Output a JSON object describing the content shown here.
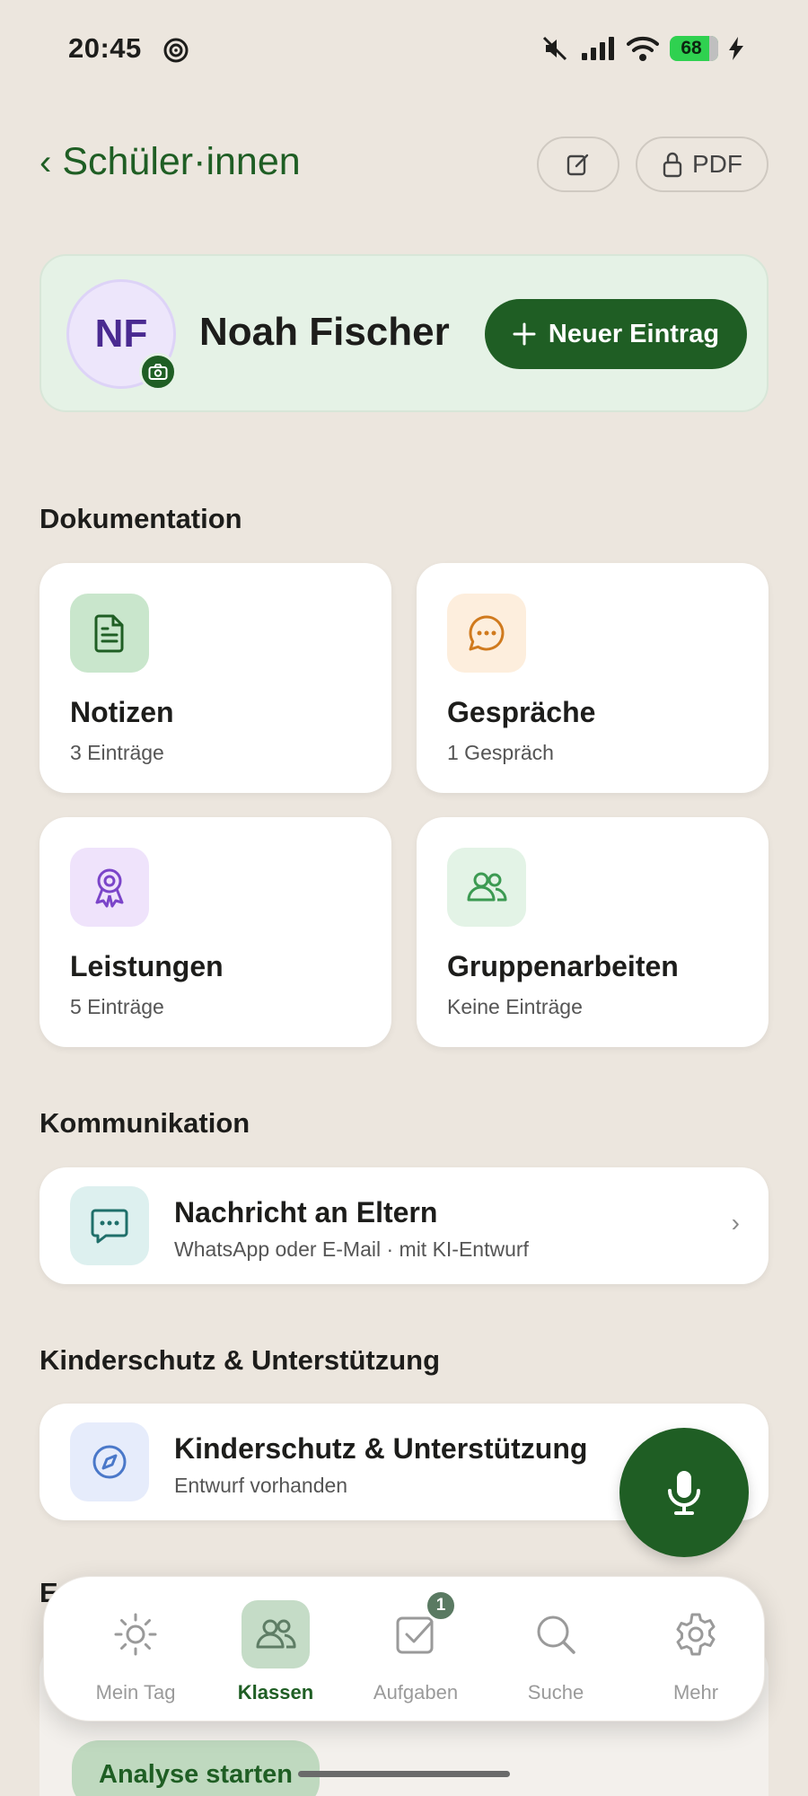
{
  "status_bar": {
    "time": "20:45",
    "battery": "68"
  },
  "header": {
    "back_label": "Schüler·innen",
    "pdf_label": "PDF"
  },
  "profile": {
    "initials": "NF",
    "name": "Noah Fischer",
    "new_entry_label": "Neuer Eintrag"
  },
  "sections": {
    "documentation": "Dokumentation",
    "communication": "Kommunikation",
    "child_protection": "Kinderschutz & Unterstützung",
    "partial_next": "E"
  },
  "tiles": [
    {
      "title": "Notizen",
      "subtitle": "3 Einträge",
      "icon": "document-icon",
      "icon_bg": "#c9e6cc",
      "icon_color": "#1f5e24"
    },
    {
      "title": "Gespräche",
      "subtitle": "1 Gespräch",
      "icon": "chat-bubble-icon",
      "icon_bg": "#fdeedd",
      "icon_color": "#d07a1e"
    },
    {
      "title": "Leistungen",
      "subtitle": "5 Einträge",
      "icon": "award-icon",
      "icon_bg": "#efe3fb",
      "icon_color": "#7b45c9"
    },
    {
      "title": "Gruppenarbeiten",
      "subtitle": "Keine Einträge",
      "icon": "group-icon",
      "icon_bg": "#e3f3e6",
      "icon_color": "#3c9a52"
    }
  ],
  "communication_card": {
    "title": "Nachricht an Eltern",
    "subtitle": "WhatsApp oder E-Mail · mit KI-Entwurf"
  },
  "child_protection_card": {
    "title": "Kinderschutz & Unterstützung",
    "subtitle": "Entwurf vorhanden"
  },
  "analyse_button": "Analyse starten",
  "tabbar": {
    "items": [
      {
        "label": "Mein Tag",
        "icon": "sun-icon"
      },
      {
        "label": "Klassen",
        "icon": "people-icon",
        "active": true
      },
      {
        "label": "Aufgaben",
        "icon": "task-check-icon",
        "badge": "1"
      },
      {
        "label": "Suche",
        "icon": "search-icon"
      },
      {
        "label": "Mehr",
        "icon": "gear-icon"
      }
    ]
  },
  "colors": {
    "brand_green": "#1f5e24",
    "background": "#ece6de",
    "profile_bg": "#e5f2e6"
  }
}
